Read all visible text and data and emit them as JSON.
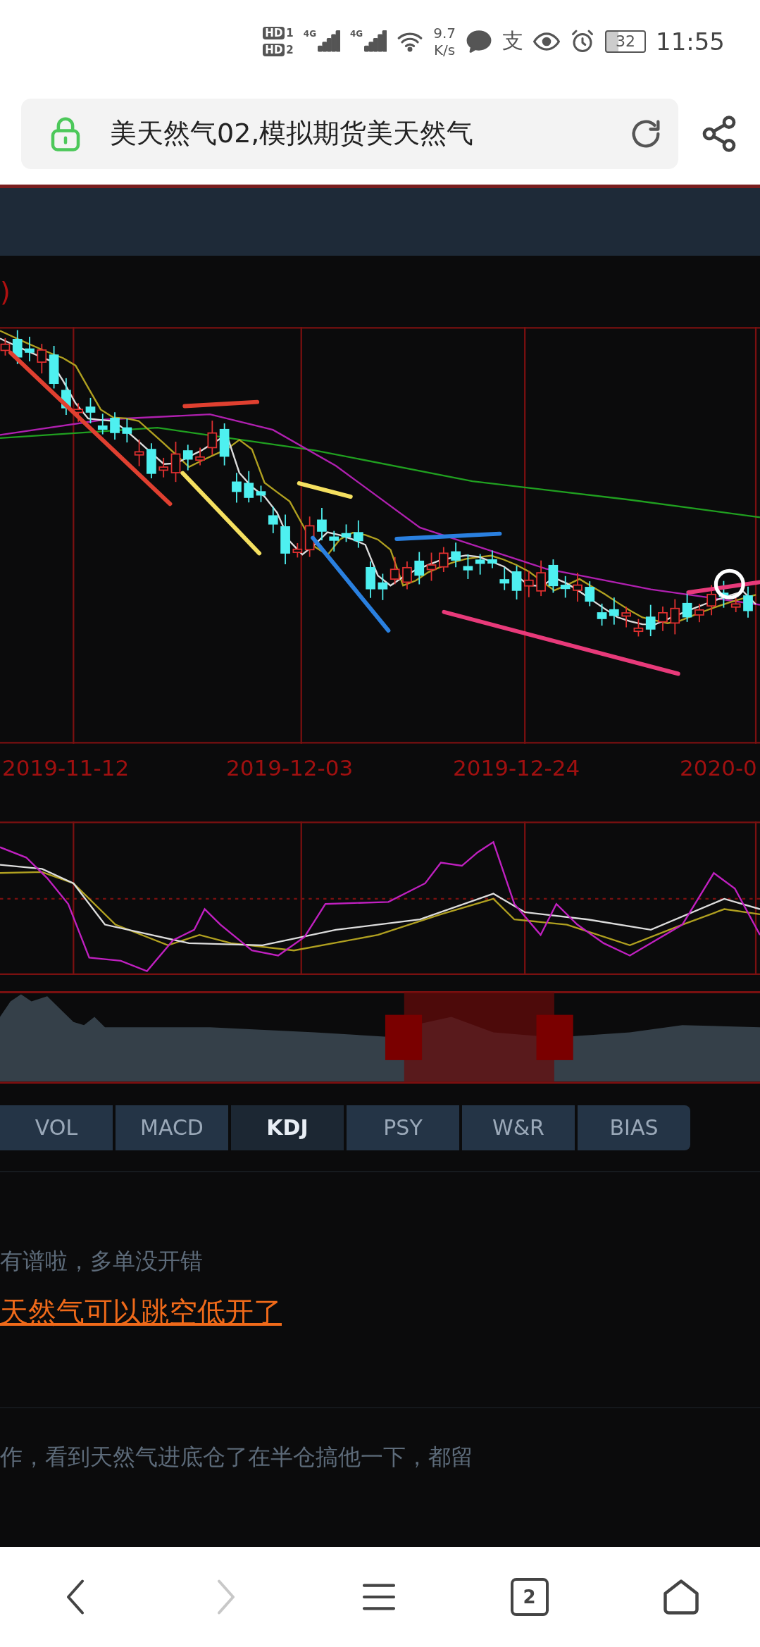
{
  "status_bar": {
    "sim_badges": [
      {
        "label": "HD",
        "index": "1"
      },
      {
        "label": "HD",
        "index": "2"
      }
    ],
    "networks": [
      "4G",
      "4G"
    ],
    "speed": {
      "value": "9.7",
      "unit": "K/s"
    },
    "app_glyph": "支",
    "battery": "32",
    "time": "11:55"
  },
  "address_bar": {
    "title": "美天然气02,模拟期货美天然气",
    "secure": true
  },
  "chart": {
    "legend_fragment": ")",
    "x_labels": [
      "2019-11-12",
      "2019-12-03",
      "2019-12-24",
      "2020-0"
    ]
  },
  "indicator_tabs": [
    {
      "label": "VOL",
      "selected": false
    },
    {
      "label": "MACD",
      "selected": false
    },
    {
      "label": "KDJ",
      "selected": true
    },
    {
      "label": "PSY",
      "selected": false
    },
    {
      "label": "W&R",
      "selected": false
    },
    {
      "label": "BIAS",
      "selected": false
    }
  ],
  "posts": [
    {
      "text": "有谱啦，多单没开错",
      "link": "天然气可以跳空低开了"
    },
    {
      "text": "作，看到天然气进底仓了在半仓搞他一下，都留"
    }
  ],
  "bottom_nav": {
    "tab_count": "2",
    "forward_disabled": true
  }
}
